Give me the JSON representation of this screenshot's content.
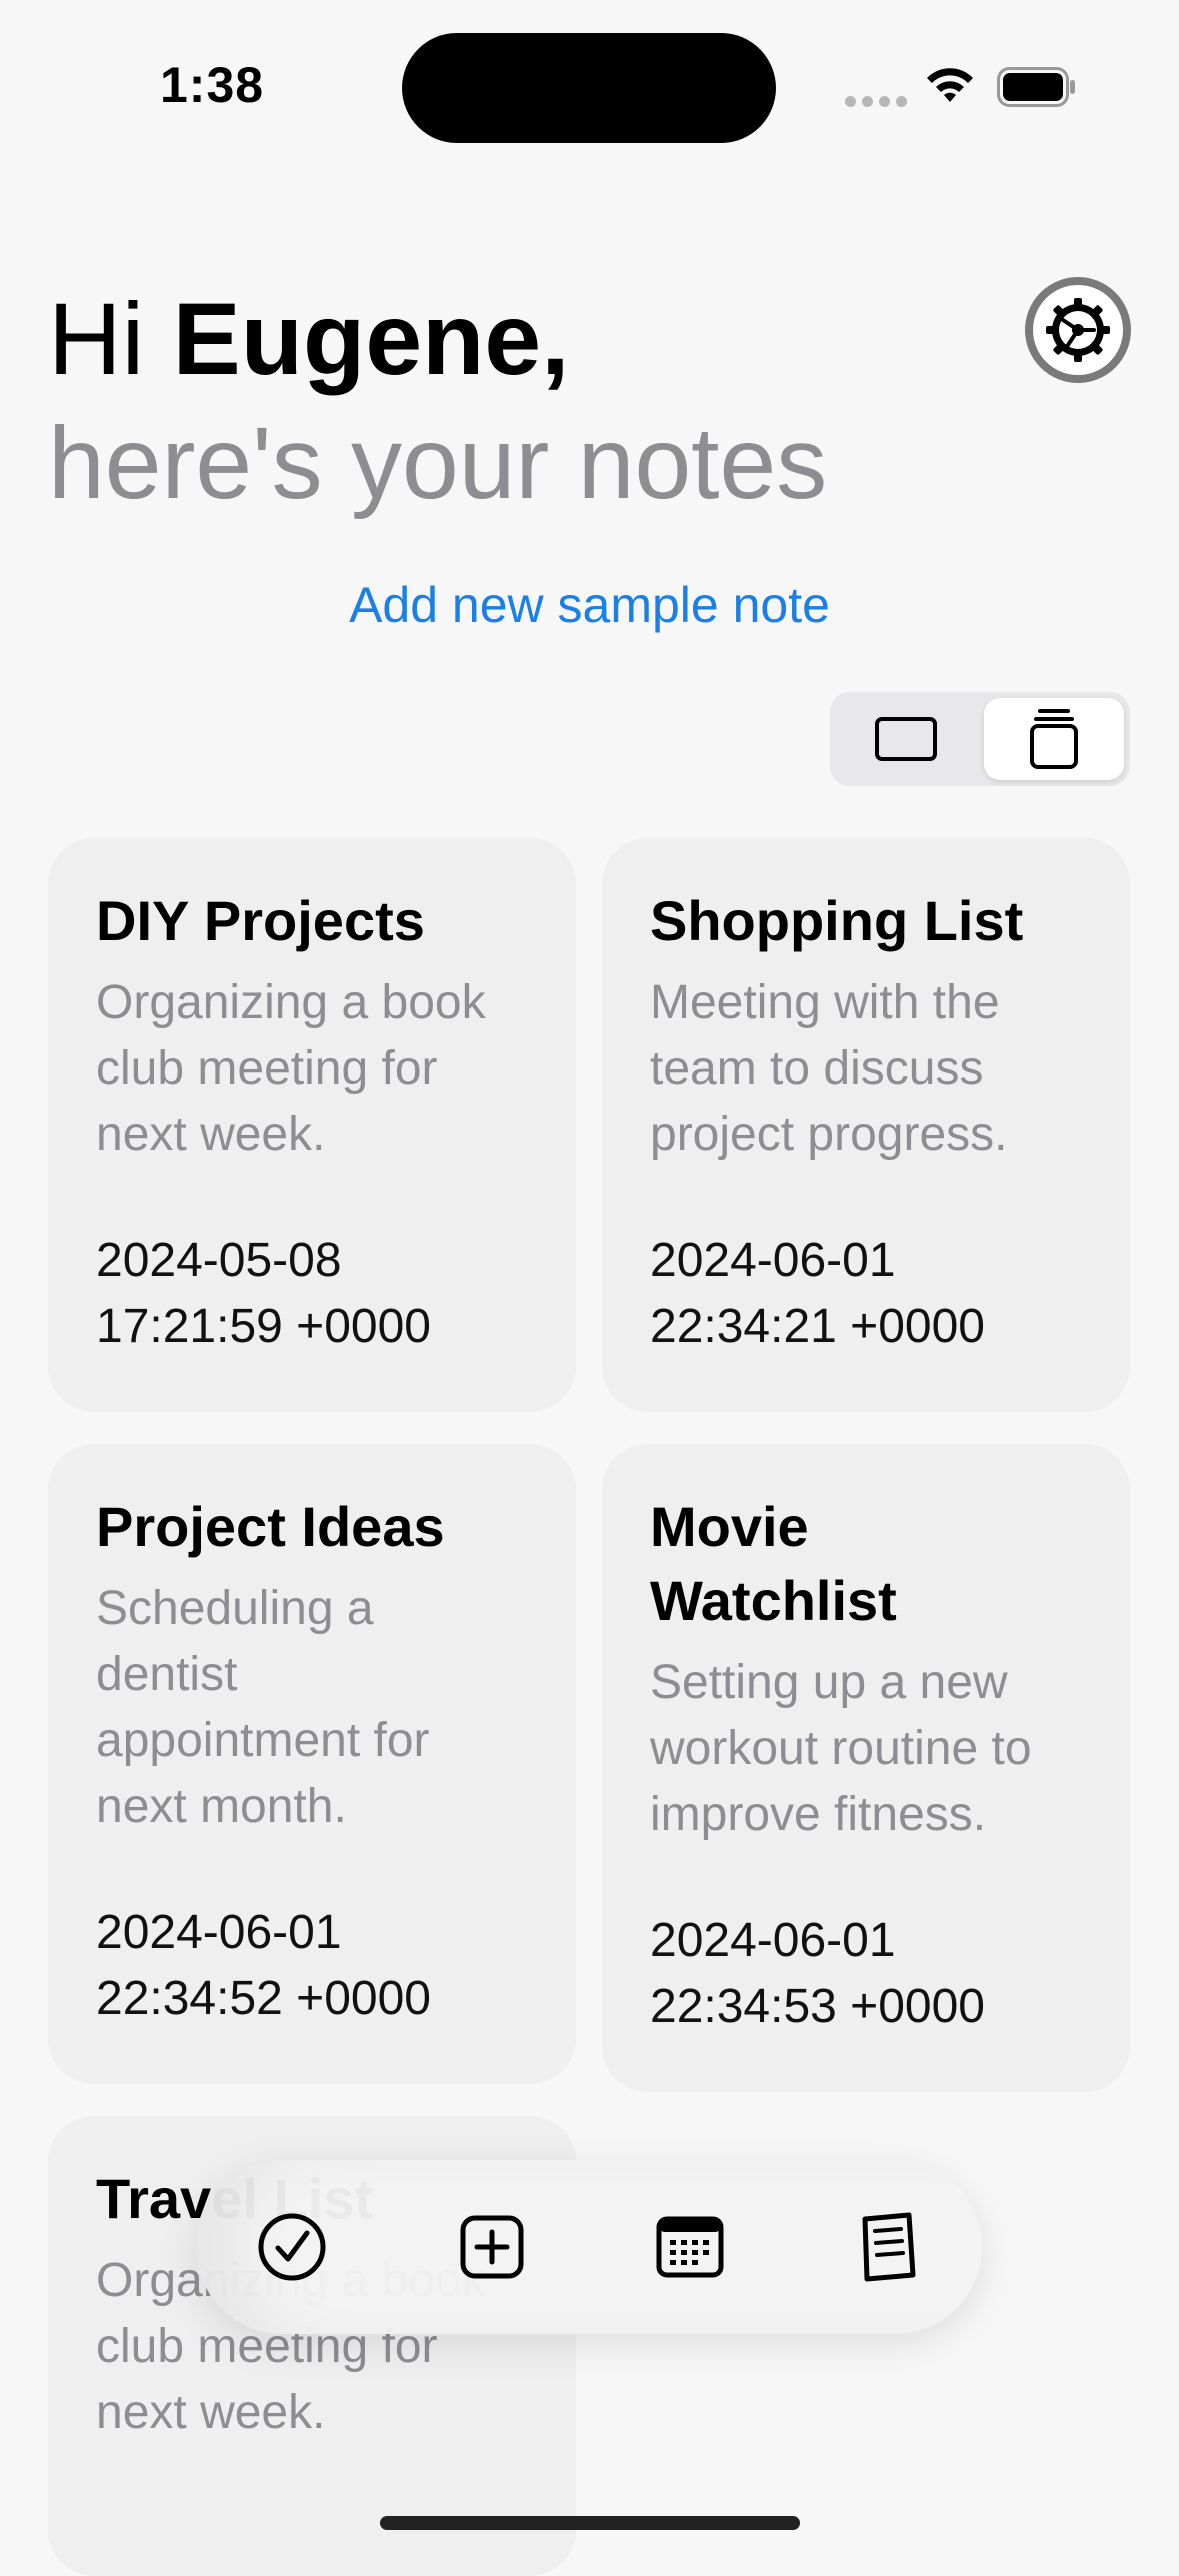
{
  "status_bar": {
    "time": "1:38"
  },
  "header": {
    "greeting_prefix": "Hi ",
    "user_name": "Eugene,",
    "subtitle": "here's your notes"
  },
  "actions": {
    "add_sample_note": "Add new sample note"
  },
  "notes": [
    {
      "title": "DIY Projects",
      "body": "Organizing a book club meeting for next week.",
      "date": "2024-05-08",
      "time": "17:21:59 +0000"
    },
    {
      "title": "Shopping List",
      "body": "Meeting with the team to discuss project progress.",
      "date": "2024-06-01",
      "time": "22:34:21 +0000"
    },
    {
      "title": "Project Ideas",
      "body": "Scheduling a dentist appointment for next month.",
      "date": "2024-06-01",
      "time": "22:34:52 +0000"
    },
    {
      "title": "Movie Watchlist",
      "body": "Setting up a new workout routine to improve fitness.",
      "date": "2024-06-01",
      "time": "22:34:53 +0000"
    },
    {
      "title": "Travel List",
      "body": "Organizing a book club meeting for next week."
    }
  ],
  "layout_toggle": {
    "options": [
      "single-view",
      "stacked-view"
    ],
    "selected": "stacked-view"
  },
  "tabbar": {
    "icons": [
      "checkmark-circle-icon",
      "plus-square-icon",
      "calendar-icon",
      "notes-icon"
    ]
  },
  "colors": {
    "accent": "#1a7fe6",
    "secondary_text": "#8e8e92",
    "card_background": "#efefef",
    "page_background": "#f7f7f7"
  }
}
